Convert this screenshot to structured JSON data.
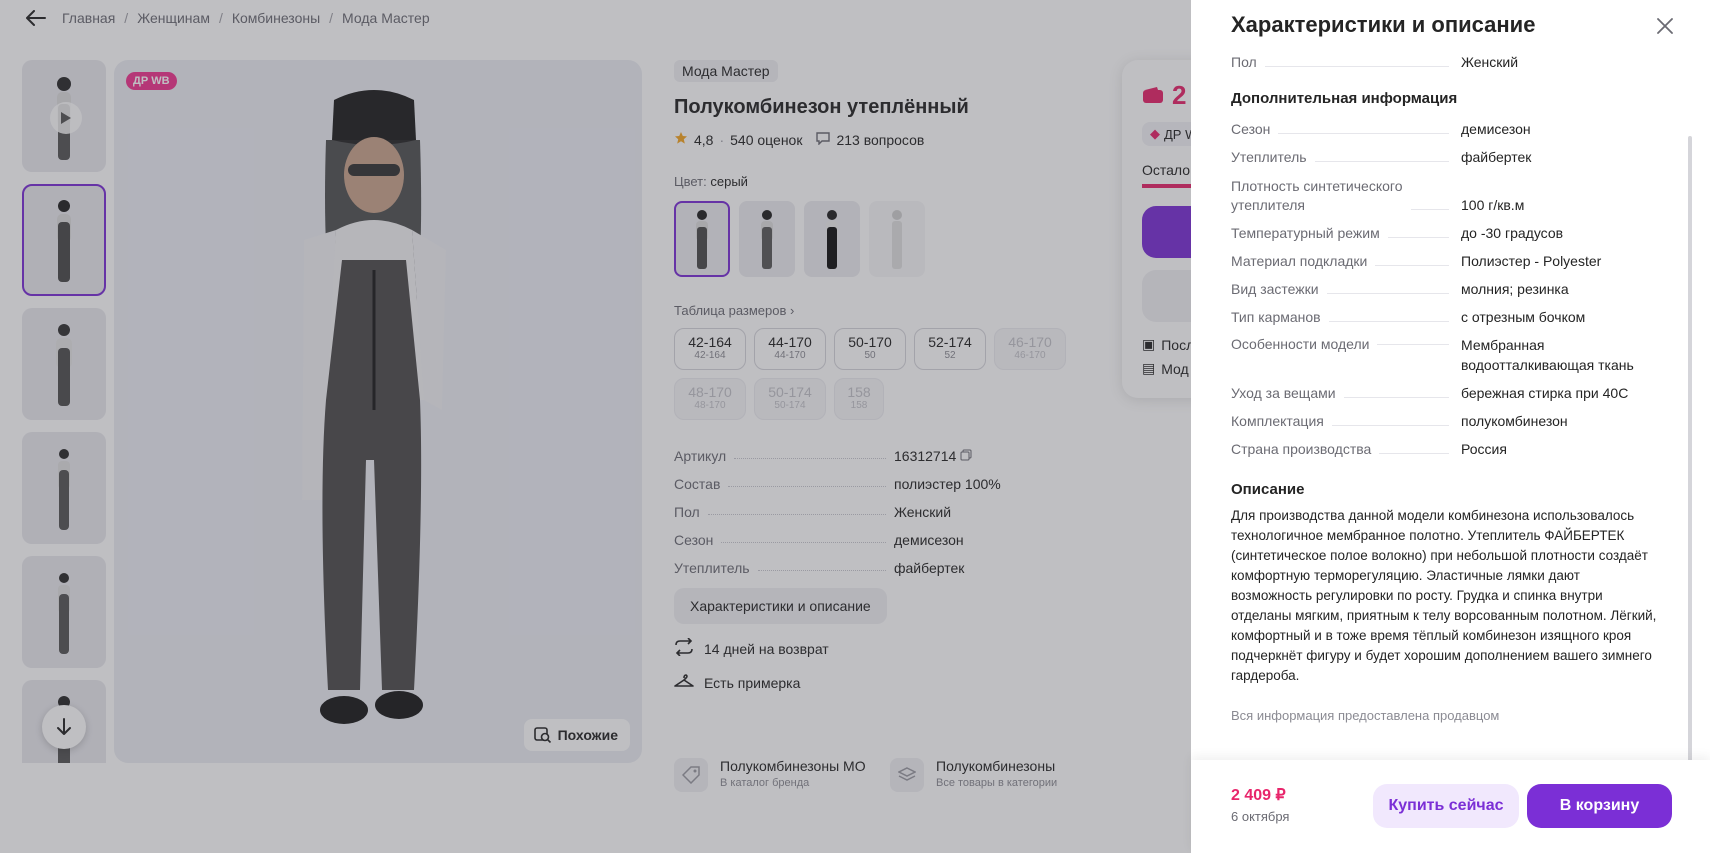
{
  "breadcrumbs": [
    "Главная",
    "Женщинам",
    "Комбинезоны",
    "Мода Мастер"
  ],
  "gallery": {
    "badge": "ДР WB",
    "similar_label": "Похожие"
  },
  "product": {
    "brand": "Мода Мастер",
    "title": "Полукомбинезон утеплённый",
    "rating": "4,8",
    "reviews": "540 оценок",
    "questions": "213 вопросов",
    "color_label": "Цвет:",
    "color_value": "серый",
    "size_table_label": "Таблица размеров",
    "sizes": [
      {
        "s": "42-164",
        "r": "42-164",
        "available": true
      },
      {
        "s": "44-170",
        "r": "44-170",
        "available": true
      },
      {
        "s": "50-170",
        "r": "50",
        "available": true
      },
      {
        "s": "52-174",
        "r": "52",
        "available": true
      },
      {
        "s": "46-170",
        "r": "46-170",
        "available": false
      },
      {
        "s": "48-170",
        "r": "48-170",
        "available": false
      },
      {
        "s": "50-174",
        "r": "50-174",
        "available": false
      },
      {
        "s": "158",
        "r": "158",
        "available": false
      }
    ],
    "specs": [
      {
        "k": "Артикул",
        "v": "16312714"
      },
      {
        "k": "Состав",
        "v": "полиэстер 100%"
      },
      {
        "k": "Пол",
        "v": "Женский"
      },
      {
        "k": "Сезон",
        "v": "демисезон"
      },
      {
        "k": "Утеплитель",
        "v": "файбертек"
      }
    ],
    "char_button": "Характеристики и описание",
    "returns": "14 дней на возврат",
    "fitting": "Есть примерка"
  },
  "shortcuts": [
    {
      "title": "Полукомбинезоны МО",
      "sub": "В каталог бренда"
    },
    {
      "title": "Полукомбинезоны",
      "sub": "Все товары в категории"
    }
  ],
  "buybox": {
    "price_partial": "2",
    "dr_partial": "ДР W",
    "stock_partial": "Остало",
    "line1_partial": "Посл",
    "line2_partial": "Мод"
  },
  "drawer": {
    "title": "Характеристики и описание",
    "top_rows": [
      {
        "k": "Пол",
        "v": "Женский"
      }
    ],
    "section_additional": "Дополнительная информация",
    "rows": [
      {
        "k": "Сезон",
        "v": "демисезон"
      },
      {
        "k": "Утеплитель",
        "v": "файбертек"
      },
      {
        "k": "Плотность синтетического\nутеплителя",
        "v": "100 г/кв.м"
      },
      {
        "k": "Температурный режим",
        "v": "до -30 градусов"
      },
      {
        "k": "Материал подкладки",
        "v": "Полиэстер - Polyester"
      },
      {
        "k": "Вид застежки",
        "v": "молния; резинка"
      },
      {
        "k": "Тип карманов",
        "v": "с отрезным бочком"
      },
      {
        "k": "Особенности модели",
        "v": "Мембранная\nводоотталкивающая ткань"
      },
      {
        "k": "Уход за вещами",
        "v": "бережная стирка при 40С"
      },
      {
        "k": "Комплектация",
        "v": "полукомбинезон"
      },
      {
        "k": "Страна производства",
        "v": "Россия"
      }
    ],
    "section_description": "Описание",
    "description": "Для производства данной модели комбинезона использовалось технологичное мембранное полотно. Утеплитель ФАЙБЕРТЕК (синтетическое полое волокно) при небольшой плотности создаёт комфортную терморегуляцию. Эластичные лямки дают возможность регулировки по росту. Грудка и спинка внутри отделаны мягким, приятным к телу ворсованным полотном. Лёгкий, комфортный и в тоже время тёплый комбинезон изящного кроя подчеркнёт фигуру и будет хорошим дополнением вашего зимнего гардероба.",
    "source_note": "Вся информация предоставлена продавцом",
    "footer": {
      "price": "2 409 ₽",
      "date": "6 октября",
      "buy_now": "Купить сейчас",
      "add_to_cart": "В корзину"
    }
  },
  "colors": {
    "accent": "#7b2fd6",
    "price": "#e8256b",
    "badge": "#f1358f"
  }
}
